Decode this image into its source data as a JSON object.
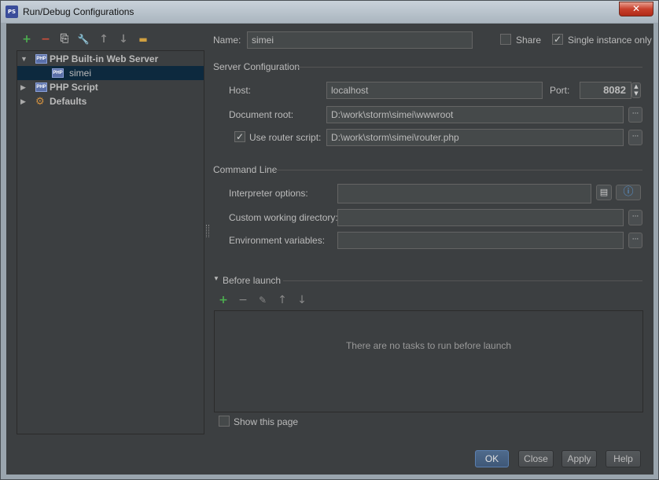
{
  "window": {
    "title": "Run/Debug Configurations",
    "close_label": "✕"
  },
  "toolbar": {
    "add": "+",
    "remove": "−",
    "copy": "⎘",
    "edit_defaults": "🔧",
    "move_up": "↑",
    "move_down": "↓",
    "folder": "▬"
  },
  "tree": {
    "items": [
      {
        "label": "PHP Built-in Web Server",
        "expanded": true,
        "bold": true
      },
      {
        "label": "simei",
        "selected": true
      },
      {
        "label": "PHP Script",
        "expanded": false,
        "bold": true
      },
      {
        "label": "Defaults",
        "expanded": false,
        "bold": true
      }
    ]
  },
  "form": {
    "name_label": "Name:",
    "name_value": "simei",
    "share_label": "Share",
    "share_checked": false,
    "single_instance_label": "Single instance only",
    "single_instance_checked": true
  },
  "server_config": {
    "section_title": "Server Configuration",
    "host_label": "Host:",
    "host_value": "localhost",
    "port_label": "Port:",
    "port_value": "8082",
    "docroot_label": "Document root:",
    "docroot_value": "D:\\work\\storm\\simei\\wwwroot",
    "router_label": "Use router script:",
    "router_checked": true,
    "router_value": "D:\\work\\storm\\simei\\router.php"
  },
  "command_line": {
    "section_title": "Command Line",
    "interp_label": "Interpreter options:",
    "interp_value": "",
    "cwd_label": "Custom working directory:",
    "cwd_value": "",
    "env_label": "Environment variables:",
    "env_value": ""
  },
  "before_launch": {
    "section_title": "Before launch",
    "empty_message": "There are no tasks to run before launch",
    "show_page_label": "Show this page",
    "show_page_checked": false
  },
  "buttons": {
    "ok": "OK",
    "close": "Close",
    "apply": "Apply",
    "help": "Help"
  },
  "colors": {
    "background": "#3c3f41",
    "selection": "#0d293e",
    "add_green": "#4caf50",
    "remove_red": "#d0503c"
  }
}
